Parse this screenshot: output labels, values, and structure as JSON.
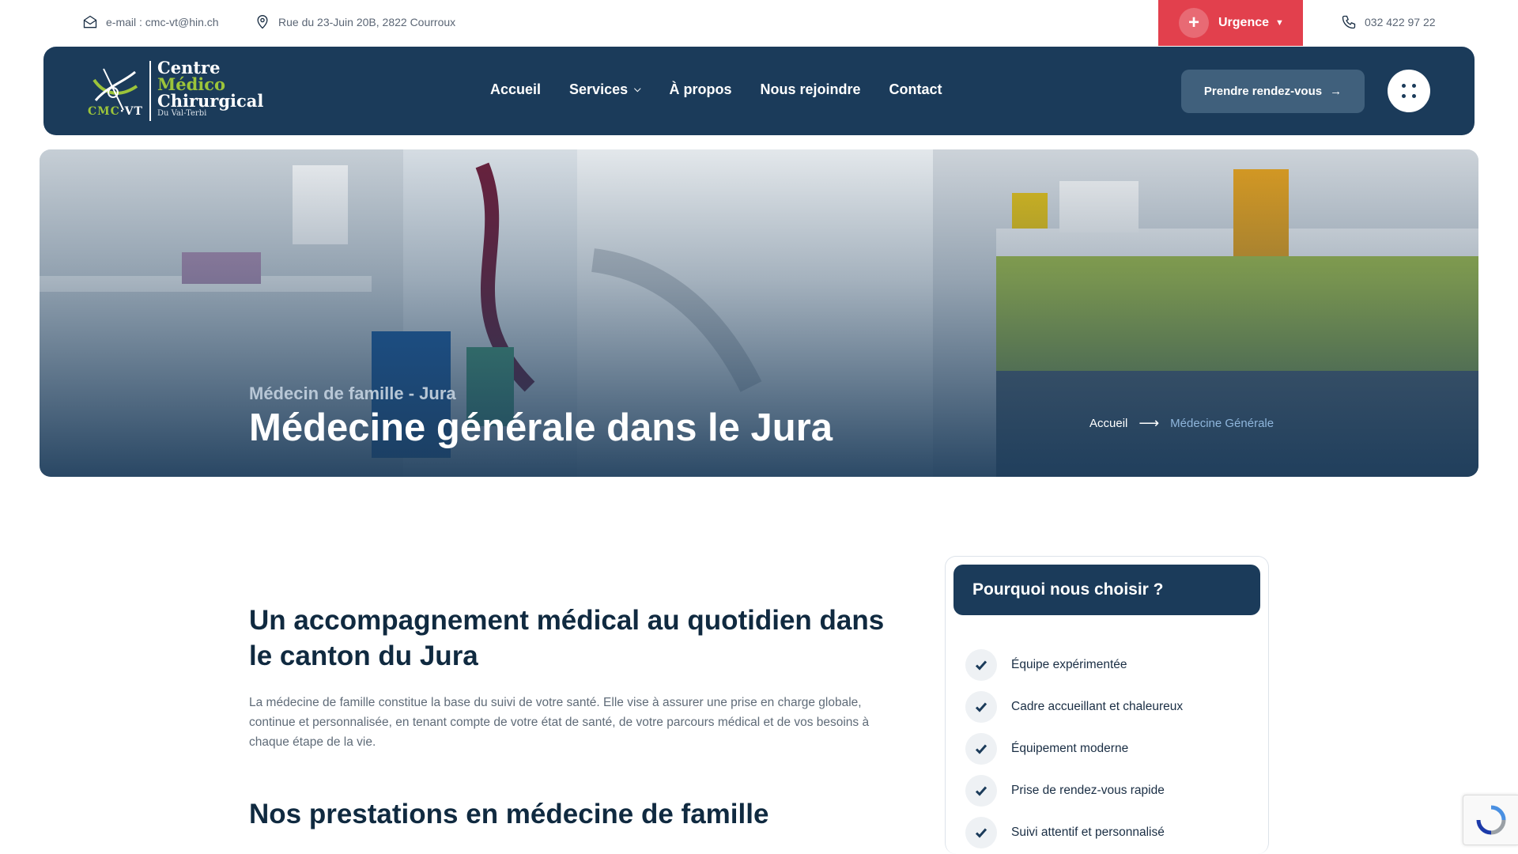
{
  "topbar": {
    "email": "e-mail : cmc-vt@hin.ch",
    "address": "Rue du 23-Juin 20B, 2822 Courroux",
    "urgence_label": "Urgence",
    "phone": "032 422 97 22"
  },
  "logo": {
    "line1": "Centre",
    "line2": "Médico",
    "line3": "Chirurgical",
    "line4": "Du Val-Terbi",
    "abbr_a": "CMC",
    "abbr_b": "·VT"
  },
  "nav": {
    "items": [
      {
        "label": "Accueil"
      },
      {
        "label": "Services"
      },
      {
        "label": "À propos"
      },
      {
        "label": "Nous rejoindre"
      },
      {
        "label": "Contact"
      }
    ],
    "cta_label": "Prendre rendez-vous"
  },
  "hero": {
    "subtitle": "Médecin de famille - Jura",
    "title": "Médecine générale dans le Jura",
    "breadcrumb_home": "Accueil",
    "breadcrumb_current": "Médecine Générale"
  },
  "main": {
    "heading": "Un accompagnement médical au quotidien dans le canton du Jura",
    "paragraph": "La médecine de famille constitue la base du suivi de votre santé. Elle vise à assurer une prise en charge globale, continue et personnalisée, en tenant compte de votre état de santé, de votre parcours médical et de vos besoins à chaque étape de la vie.",
    "subheading": "Nos prestations en médecine de famille"
  },
  "why": {
    "title": "Pourquoi nous choisir ?",
    "items": [
      "Équipe expérimentée",
      "Cadre accueillant et chaleureux",
      "Équipement moderne",
      "Prise de rendez-vous rapide",
      "Suivi attentif et personnalisé"
    ]
  },
  "colors": {
    "navy": "#1b3b5a",
    "urgence_red": "#e2404d",
    "accent_green": "#9cc43a",
    "breadcrumb_blue": "#8fb6dc"
  }
}
